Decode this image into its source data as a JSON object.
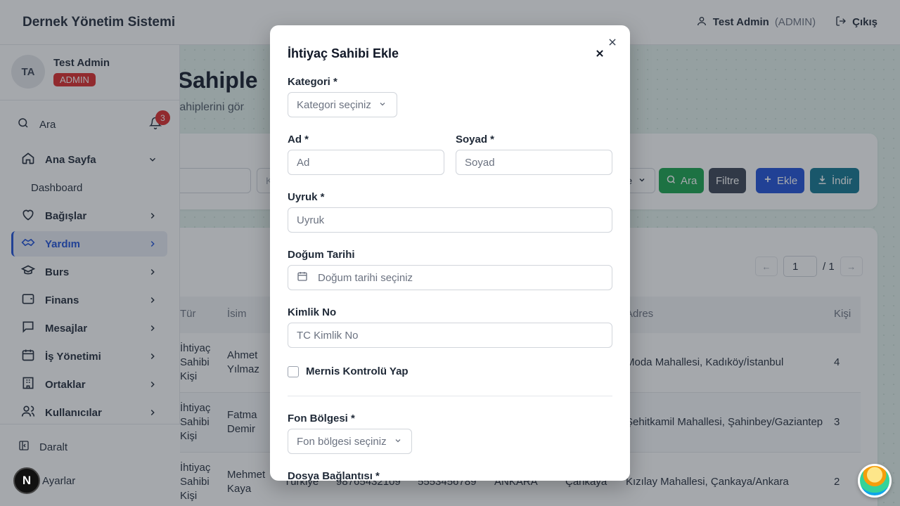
{
  "header": {
    "app_title": "Dernek Yönetim Sistemi",
    "user_name": "Test Admin",
    "user_role": "(ADMIN)",
    "logout_label": "Çıkış"
  },
  "sidebar": {
    "avatar_initials": "TA",
    "user_name": "Test Admin",
    "role_badge": "ADMIN",
    "search_label": "Ara",
    "notification_count": "3",
    "items": [
      {
        "label": "Ana Sayfa",
        "icon": "home-icon",
        "expanded": true
      },
      {
        "label": "Bağışlar",
        "icon": "heart-icon"
      },
      {
        "label": "Yardım",
        "icon": "handshake-icon",
        "active": true
      },
      {
        "label": "Burs",
        "icon": "graduation-cap-icon"
      },
      {
        "label": "Finans",
        "icon": "wallet-icon"
      },
      {
        "label": "Mesajlar",
        "icon": "message-icon"
      },
      {
        "label": "İş Yönetimi",
        "icon": "calendar-icon"
      },
      {
        "label": "Ortaklar",
        "icon": "building-icon"
      },
      {
        "label": "Kullanıcılar",
        "icon": "users-icon"
      }
    ],
    "sub_item": "Dashboard",
    "collapse_label": "Daralt",
    "settings_label": "Ayarlar"
  },
  "page": {
    "title": "ç Sahiple",
    "subtitle": "aç sahiplerini gör",
    "filter_partial": "K",
    "filter_select_partial": "e",
    "buttons": {
      "search": "Ara",
      "filter": "Filtre",
      "add": "Ekle",
      "download": "İndir"
    },
    "pager": {
      "prev": "←",
      "page": "1",
      "total": "/ 1",
      "next": "→"
    },
    "table": {
      "headers": {
        "tur": "Tür",
        "isim": "İsim",
        "adres": "Adres",
        "kisi": "Kişi"
      },
      "rows": [
        {
          "tur": "İhtiyaç Sahibi Kişi",
          "isim": "Ahmet Yılmaz",
          "adres": "Moda Mahallesi, Kadıköy/İstanbul",
          "kisi": "4"
        },
        {
          "tur": "İhtiyaç Sahibi Kişi",
          "isim": "Fatma Demir",
          "adres": "Şehitkamil Mahallesi, Şahinbey/Gaziantep",
          "kisi": "3"
        },
        {
          "tur": "İhtiyaç Sahibi Kişi",
          "isim": "Mehmet Kaya",
          "uyruk": "Türkiye",
          "kimlik": "98765432109",
          "telefon": "5553456789",
          "sehir": "ANKARA",
          "ilce": "Çankaya",
          "adres": "Kızılay Mahallesi, Çankaya/Ankara",
          "kisi": "2"
        }
      ]
    }
  },
  "modal": {
    "title": "İhtiyaç Sahibi Ekle",
    "kategori_label": "Kategori *",
    "kategori_placeholder": "Kategori seçiniz",
    "ad_label": "Ad *",
    "ad_placeholder": "Ad",
    "soyad_label": "Soyad *",
    "soyad_placeholder": "Soyad",
    "uyruk_label": "Uyruk *",
    "uyruk_placeholder": "Uyruk",
    "dogum_label": "Doğum Tarihi",
    "dogum_placeholder": "Doğum tarihi seçiniz",
    "kimlik_label": "Kimlik No",
    "kimlik_placeholder": "TC Kimlik No",
    "mernis_label": "Mernis Kontrolü Yap",
    "fon_label": "Fon Bölgesi *",
    "fon_placeholder": "Fon bölgesi seçiniz",
    "dosya_label": "Dosya Bağlantısı *"
  },
  "floating": {
    "badge_letter": "N"
  },
  "colors": {
    "primary": "#1d4ed8",
    "success": "#16a34a",
    "dark": "#374151",
    "info": "#0e7490",
    "danger": "#dc2626"
  }
}
